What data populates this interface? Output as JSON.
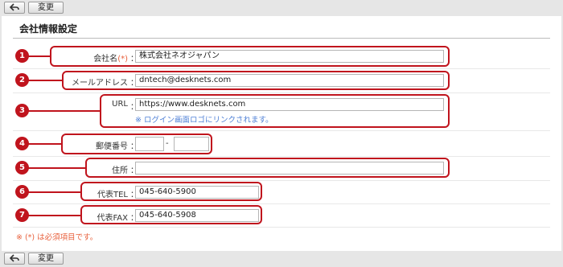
{
  "toolbar": {
    "back_icon": "back-arrow-icon",
    "change_label": "変更"
  },
  "section_title": "会社情報設定",
  "fields": {
    "company_name": {
      "label": "会社名",
      "required_mark": "(*)",
      "colon": "：",
      "value": "株式会社ネオジャパン"
    },
    "mail_address": {
      "label": "メールアドレス",
      "colon": "：",
      "value": "dntech@desknets.com"
    },
    "url": {
      "label": "URL",
      "colon": "：",
      "value": "https://www.desknets.com",
      "note": "※ ログイン画面ロゴにリンクされます。"
    },
    "postal_code": {
      "label": "郵便番号",
      "colon": "：",
      "value1": "",
      "separator": "-",
      "value2": ""
    },
    "address": {
      "label": "住所",
      "colon": "：",
      "value": ""
    },
    "tel": {
      "label": "代表TEL",
      "colon": "：",
      "value": "045-640-5900"
    },
    "fax": {
      "label": "代表FAX",
      "colon": "：",
      "value": "045-640-5908"
    }
  },
  "footnote": "※ (*) は必須項目です。",
  "callouts": [
    "1",
    "2",
    "3",
    "4",
    "5",
    "6",
    "7"
  ],
  "colors": {
    "callout": "#c0141d",
    "required": "#e8603c",
    "note": "#4d7fd6"
  }
}
